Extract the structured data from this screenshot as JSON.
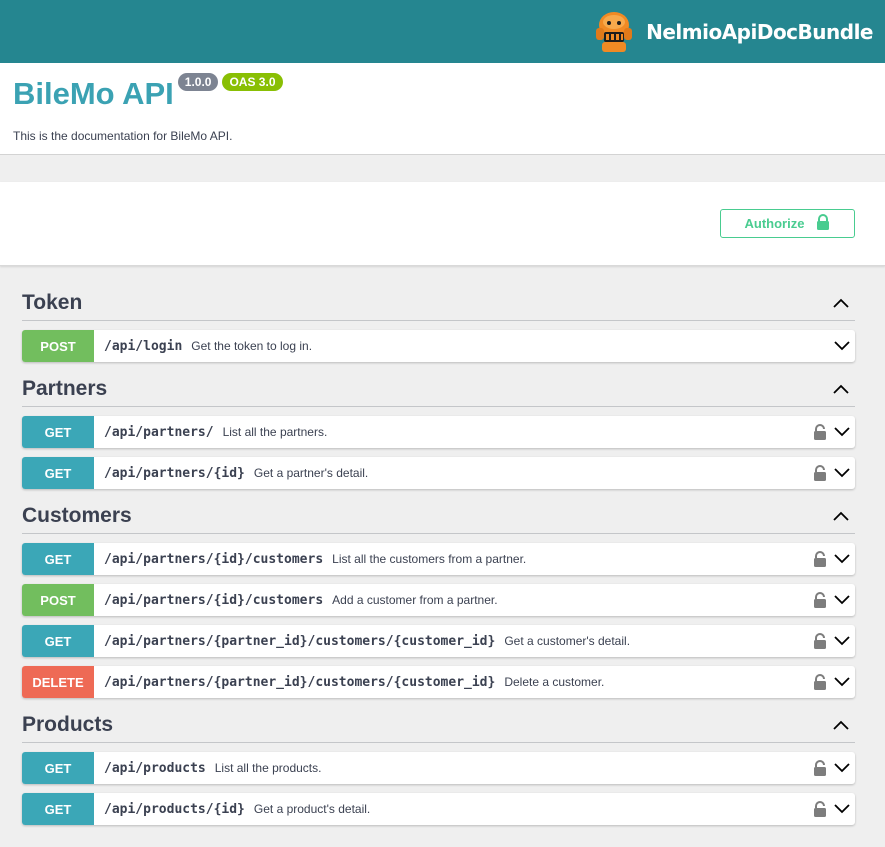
{
  "topbar": {
    "brand": "NelmioApiDocBundle",
    "logo_icon": "nelmio-robot-logo"
  },
  "info": {
    "title": "BileMo API",
    "version": "1.0.0",
    "oas": "OAS 3.0",
    "description": "This is the documentation for BileMo API."
  },
  "scheme": {
    "authorize_label": "Authorize"
  },
  "colors": {
    "get": "#3ba7b7",
    "post": "#72be5e",
    "delete": "#ee6a55",
    "accent": "#258690",
    "title": "#3ba2b3",
    "authorize": "#49cc90"
  },
  "tags": [
    {
      "name": "Token",
      "ops": [
        {
          "method": "POST",
          "path": "/api/login",
          "summary": "Get the token to log in.",
          "locked": false
        }
      ]
    },
    {
      "name": "Partners",
      "ops": [
        {
          "method": "GET",
          "path": "/api/partners/",
          "summary": "List all the partners.",
          "locked": true
        },
        {
          "method": "GET",
          "path": "/api/partners/{id}",
          "summary": "Get a partner's detail.",
          "locked": true
        }
      ]
    },
    {
      "name": "Customers",
      "ops": [
        {
          "method": "GET",
          "path": "/api/partners/{id}/customers",
          "summary": "List all the customers from a partner.",
          "locked": true
        },
        {
          "method": "POST",
          "path": "/api/partners/{id}/customers",
          "summary": "Add a customer from a partner.",
          "locked": true
        },
        {
          "method": "GET",
          "path": "/api/partners/{partner_id}/customers/{customer_id}",
          "summary": "Get a customer's detail.",
          "locked": true
        },
        {
          "method": "DELETE",
          "path": "/api/partners/{partner_id}/customers/{customer_id}",
          "summary": "Delete a customer.",
          "locked": true
        }
      ]
    },
    {
      "name": "Products",
      "ops": [
        {
          "method": "GET",
          "path": "/api/products",
          "summary": "List all the products.",
          "locked": true
        },
        {
          "method": "GET",
          "path": "/api/products/{id}",
          "summary": "Get a product's detail.",
          "locked": true
        }
      ]
    }
  ]
}
